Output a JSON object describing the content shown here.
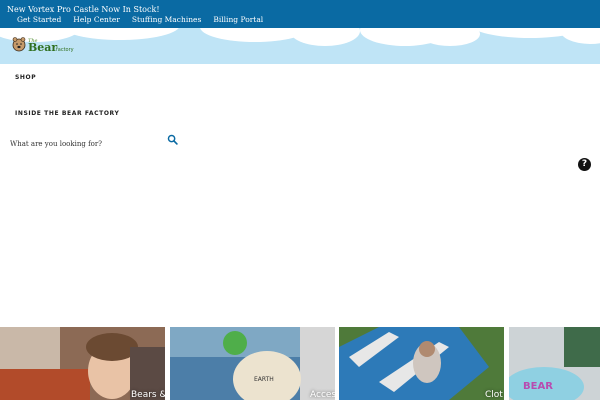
{
  "topbar": {
    "announcement": "New Vortex Pro Castle Now In Stock!",
    "links": [
      "Get Started",
      "Help Center",
      "Stuffing Machines",
      "Billing Portal"
    ]
  },
  "brand": {
    "logo_text_the": "The",
    "logo_text_bear": "Bear",
    "logo_text_factory": "factory"
  },
  "nav": {
    "shop": "SHOP",
    "inside": "INSIDE THE BEAR FACTORY"
  },
  "search": {
    "placeholder": "What are you looking for?"
  },
  "help": {
    "glyph": "?"
  },
  "categories": [
    {
      "label": "Bears &"
    },
    {
      "label": "Acces"
    },
    {
      "label": "Clot"
    },
    {
      "label": ""
    }
  ],
  "colors": {
    "topbar": "#0a6aa3",
    "cloudband": "#bfe4f6",
    "search_icon": "#0a6aa3"
  }
}
